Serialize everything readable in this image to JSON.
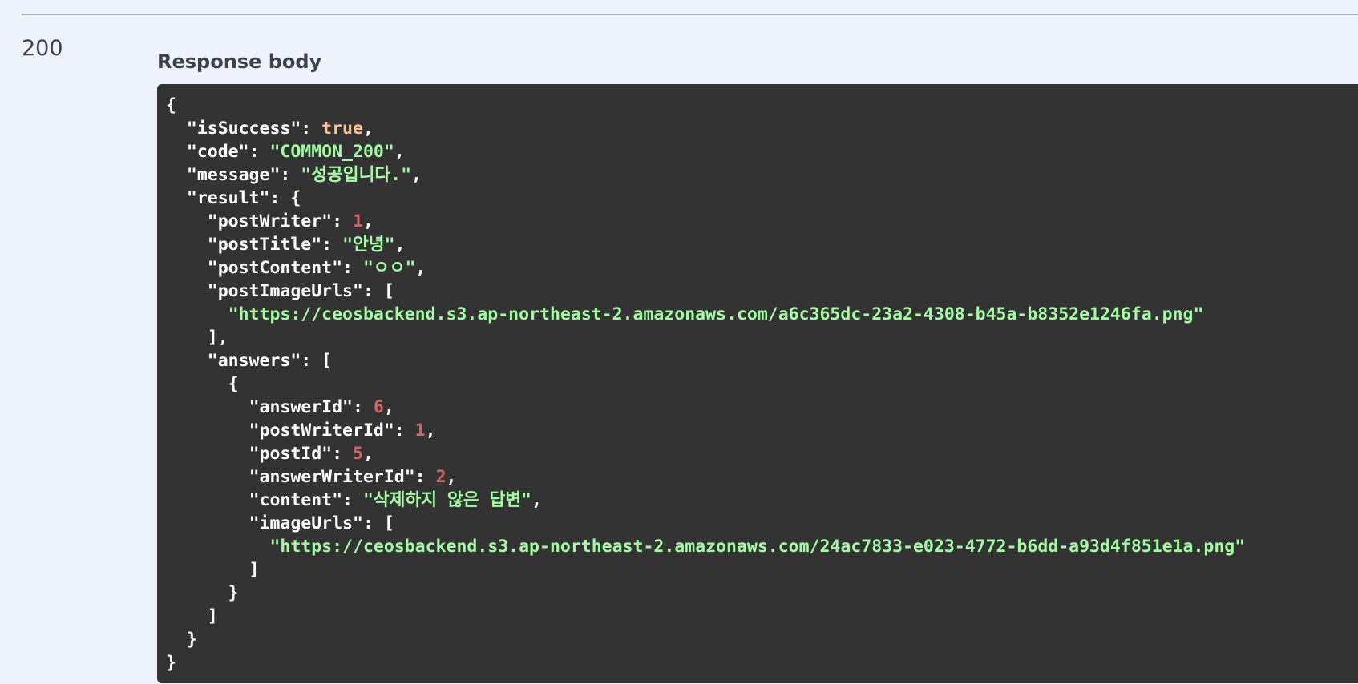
{
  "status": {
    "code": "200"
  },
  "response": {
    "title": "Response body",
    "lines": [
      [
        {
          "t": "punct",
          "v": "{"
        }
      ],
      [
        {
          "t": "punct",
          "v": "  "
        },
        {
          "t": "key",
          "v": "\"isSuccess\""
        },
        {
          "t": "punct",
          "v": ": "
        },
        {
          "t": "bool",
          "v": "true"
        },
        {
          "t": "punct",
          "v": ","
        }
      ],
      [
        {
          "t": "punct",
          "v": "  "
        },
        {
          "t": "key",
          "v": "\"code\""
        },
        {
          "t": "punct",
          "v": ": "
        },
        {
          "t": "str",
          "v": "\"COMMON_200\""
        },
        {
          "t": "punct",
          "v": ","
        }
      ],
      [
        {
          "t": "punct",
          "v": "  "
        },
        {
          "t": "key",
          "v": "\"message\""
        },
        {
          "t": "punct",
          "v": ": "
        },
        {
          "t": "str",
          "v": "\"성공입니다.\""
        },
        {
          "t": "punct",
          "v": ","
        }
      ],
      [
        {
          "t": "punct",
          "v": "  "
        },
        {
          "t": "key",
          "v": "\"result\""
        },
        {
          "t": "punct",
          "v": ": {"
        }
      ],
      [
        {
          "t": "punct",
          "v": "    "
        },
        {
          "t": "key",
          "v": "\"postWriter\""
        },
        {
          "t": "punct",
          "v": ": "
        },
        {
          "t": "num",
          "v": "1"
        },
        {
          "t": "punct",
          "v": ","
        }
      ],
      [
        {
          "t": "punct",
          "v": "    "
        },
        {
          "t": "key",
          "v": "\"postTitle\""
        },
        {
          "t": "punct",
          "v": ": "
        },
        {
          "t": "str",
          "v": "\"안녕\""
        },
        {
          "t": "punct",
          "v": ","
        }
      ],
      [
        {
          "t": "punct",
          "v": "    "
        },
        {
          "t": "key",
          "v": "\"postContent\""
        },
        {
          "t": "punct",
          "v": ": "
        },
        {
          "t": "str",
          "v": "\"ㅇㅇ\""
        },
        {
          "t": "punct",
          "v": ","
        }
      ],
      [
        {
          "t": "punct",
          "v": "    "
        },
        {
          "t": "key",
          "v": "\"postImageUrls\""
        },
        {
          "t": "punct",
          "v": ": ["
        }
      ],
      [
        {
          "t": "punct",
          "v": "      "
        },
        {
          "t": "str",
          "v": "\"https://ceosbackend.s3.ap-northeast-2.amazonaws.com/a6c365dc-23a2-4308-b45a-b8352e1246fa.png\""
        }
      ],
      [
        {
          "t": "punct",
          "v": "    ],"
        }
      ],
      [
        {
          "t": "punct",
          "v": "    "
        },
        {
          "t": "key",
          "v": "\"answers\""
        },
        {
          "t": "punct",
          "v": ": ["
        }
      ],
      [
        {
          "t": "punct",
          "v": "      {"
        }
      ],
      [
        {
          "t": "punct",
          "v": "        "
        },
        {
          "t": "key",
          "v": "\"answerId\""
        },
        {
          "t": "punct",
          "v": ": "
        },
        {
          "t": "num",
          "v": "6"
        },
        {
          "t": "punct",
          "v": ","
        }
      ],
      [
        {
          "t": "punct",
          "v": "        "
        },
        {
          "t": "key",
          "v": "\"postWriterId\""
        },
        {
          "t": "punct",
          "v": ": "
        },
        {
          "t": "num",
          "v": "1"
        },
        {
          "t": "punct",
          "v": ","
        }
      ],
      [
        {
          "t": "punct",
          "v": "        "
        },
        {
          "t": "key",
          "v": "\"postId\""
        },
        {
          "t": "punct",
          "v": ": "
        },
        {
          "t": "num",
          "v": "5"
        },
        {
          "t": "punct",
          "v": ","
        }
      ],
      [
        {
          "t": "punct",
          "v": "        "
        },
        {
          "t": "key",
          "v": "\"answerWriterId\""
        },
        {
          "t": "punct",
          "v": ": "
        },
        {
          "t": "num",
          "v": "2"
        },
        {
          "t": "punct",
          "v": ","
        }
      ],
      [
        {
          "t": "punct",
          "v": "        "
        },
        {
          "t": "key",
          "v": "\"content\""
        },
        {
          "t": "punct",
          "v": ": "
        },
        {
          "t": "str",
          "v": "\"삭제하지 않은 답변\""
        },
        {
          "t": "punct",
          "v": ","
        }
      ],
      [
        {
          "t": "punct",
          "v": "        "
        },
        {
          "t": "key",
          "v": "\"imageUrls\""
        },
        {
          "t": "punct",
          "v": ": ["
        }
      ],
      [
        {
          "t": "punct",
          "v": "          "
        },
        {
          "t": "str",
          "v": "\"https://ceosbackend.s3.ap-northeast-2.amazonaws.com/24ac7833-e023-4772-b6dd-a93d4f851e1a.png\""
        }
      ],
      [
        {
          "t": "punct",
          "v": "        ]"
        }
      ],
      [
        {
          "t": "punct",
          "v": "      }"
        }
      ],
      [
        {
          "t": "punct",
          "v": "    ]"
        }
      ],
      [
        {
          "t": "punct",
          "v": "  }"
        }
      ],
      [
        {
          "t": "punct",
          "v": "}"
        }
      ]
    ]
  },
  "colors": {
    "background": "#edf2fb",
    "panel": "#333333",
    "key": "#ffffff",
    "string": "#a2fca2",
    "number": "#d36363",
    "boolean": "#fcc28c"
  }
}
